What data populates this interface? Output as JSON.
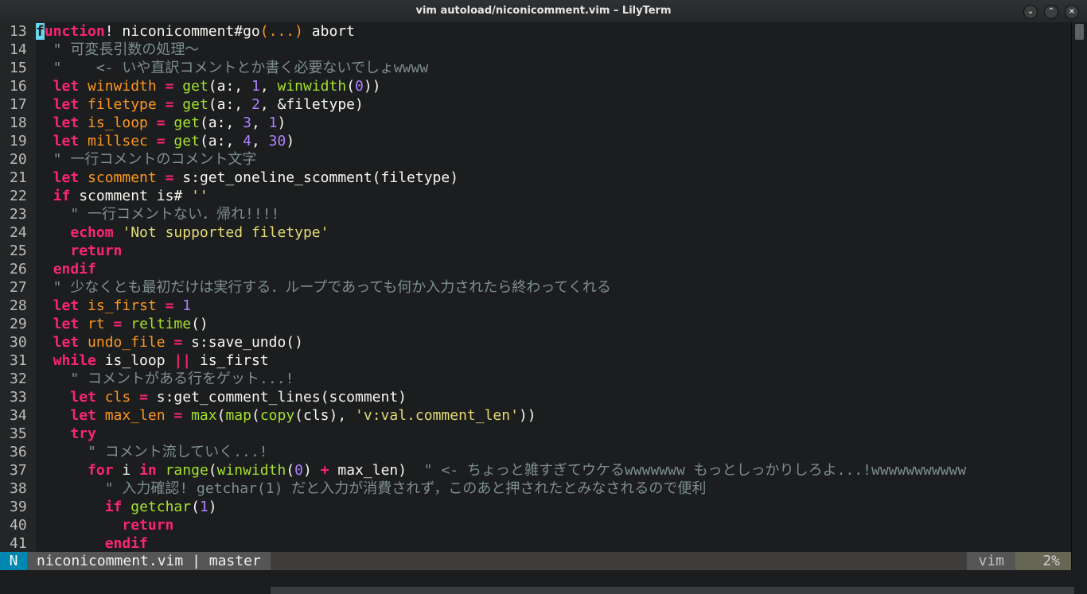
{
  "window": {
    "title": "vim autoload/niconicomment.vim – LilyTerm"
  },
  "lines": [
    {
      "n": "13",
      "tokens": [
        {
          "t": "f",
          "c": "kw cur"
        },
        {
          "t": "unction",
          "c": "kw"
        },
        {
          "t": "! niconicomment#go",
          "c": "code"
        },
        {
          "t": "(...)",
          "c": "var"
        },
        {
          "t": " abort",
          "c": "code"
        }
      ]
    },
    {
      "n": "14",
      "tokens": [
        {
          "t": "  \" 可変長引数の処理〜",
          "c": "cmt"
        }
      ]
    },
    {
      "n": "15",
      "tokens": [
        {
          "t": "  \"    <- いや直訳コメントとか書く必要ないでしょwwww",
          "c": "cmt"
        }
      ]
    },
    {
      "n": "16",
      "tokens": [
        {
          "t": "  ",
          "c": "code"
        },
        {
          "t": "let",
          "c": "kw"
        },
        {
          "t": " winwidth",
          "c": "var"
        },
        {
          "t": " = ",
          "c": "kw"
        },
        {
          "t": "get",
          "c": "fn"
        },
        {
          "t": "(a:, ",
          "c": "code"
        },
        {
          "t": "1",
          "c": "num"
        },
        {
          "t": ", ",
          "c": "code"
        },
        {
          "t": "winwidth",
          "c": "fn"
        },
        {
          "t": "(",
          "c": "code"
        },
        {
          "t": "0",
          "c": "num"
        },
        {
          "t": "))",
          "c": "code"
        }
      ]
    },
    {
      "n": "17",
      "tokens": [
        {
          "t": "  ",
          "c": "code"
        },
        {
          "t": "let",
          "c": "kw"
        },
        {
          "t": " filetype",
          "c": "var"
        },
        {
          "t": " = ",
          "c": "kw"
        },
        {
          "t": "get",
          "c": "fn"
        },
        {
          "t": "(a:, ",
          "c": "code"
        },
        {
          "t": "2",
          "c": "num"
        },
        {
          "t": ", &filetype)",
          "c": "code"
        }
      ]
    },
    {
      "n": "18",
      "tokens": [
        {
          "t": "  ",
          "c": "code"
        },
        {
          "t": "let",
          "c": "kw"
        },
        {
          "t": " is_loop",
          "c": "var"
        },
        {
          "t": " = ",
          "c": "kw"
        },
        {
          "t": "get",
          "c": "fn"
        },
        {
          "t": "(a:, ",
          "c": "code"
        },
        {
          "t": "3",
          "c": "num"
        },
        {
          "t": ", ",
          "c": "code"
        },
        {
          "t": "1",
          "c": "num"
        },
        {
          "t": ")",
          "c": "code"
        }
      ]
    },
    {
      "n": "19",
      "tokens": [
        {
          "t": "  ",
          "c": "code"
        },
        {
          "t": "let",
          "c": "kw"
        },
        {
          "t": " millsec",
          "c": "var"
        },
        {
          "t": " = ",
          "c": "kw"
        },
        {
          "t": "get",
          "c": "fn"
        },
        {
          "t": "(a:, ",
          "c": "code"
        },
        {
          "t": "4",
          "c": "num"
        },
        {
          "t": ", ",
          "c": "code"
        },
        {
          "t": "30",
          "c": "num"
        },
        {
          "t": ")",
          "c": "code"
        }
      ]
    },
    {
      "n": "20",
      "tokens": [
        {
          "t": "  \" 一行コメントのコメント文字",
          "c": "cmt"
        }
      ]
    },
    {
      "n": "21",
      "tokens": [
        {
          "t": "  ",
          "c": "code"
        },
        {
          "t": "let",
          "c": "kw"
        },
        {
          "t": " scomment",
          "c": "var"
        },
        {
          "t": " = ",
          "c": "kw"
        },
        {
          "t": "s:get_oneline_scomment(filetype)",
          "c": "code"
        }
      ]
    },
    {
      "n": "22",
      "tokens": [
        {
          "t": "  ",
          "c": "code"
        },
        {
          "t": "if",
          "c": "kw"
        },
        {
          "t": " scomment is# ",
          "c": "code"
        },
        {
          "t": "''",
          "c": "str"
        }
      ]
    },
    {
      "n": "23",
      "tokens": [
        {
          "t": "    \" 一行コメントない．帰れ!!!!",
          "c": "cmt"
        }
      ]
    },
    {
      "n": "24",
      "tokens": [
        {
          "t": "    ",
          "c": "code"
        },
        {
          "t": "echom",
          "c": "kw"
        },
        {
          "t": " 'Not supported filetype'",
          "c": "str"
        }
      ]
    },
    {
      "n": "25",
      "tokens": [
        {
          "t": "    ",
          "c": "code"
        },
        {
          "t": "return",
          "c": "kw"
        }
      ]
    },
    {
      "n": "26",
      "tokens": [
        {
          "t": "  ",
          "c": "code"
        },
        {
          "t": "endif",
          "c": "kw"
        }
      ]
    },
    {
      "n": "27",
      "tokens": [
        {
          "t": "  \" 少なくとも最初だけは実行する．ループであっても何か入力されたら終わってくれる",
          "c": "cmt"
        }
      ]
    },
    {
      "n": "28",
      "tokens": [
        {
          "t": "  ",
          "c": "code"
        },
        {
          "t": "let",
          "c": "kw"
        },
        {
          "t": " is_first",
          "c": "var"
        },
        {
          "t": " = ",
          "c": "kw"
        },
        {
          "t": "1",
          "c": "num"
        }
      ]
    },
    {
      "n": "29",
      "tokens": [
        {
          "t": "  ",
          "c": "code"
        },
        {
          "t": "let",
          "c": "kw"
        },
        {
          "t": " rt",
          "c": "var"
        },
        {
          "t": " = ",
          "c": "kw"
        },
        {
          "t": "reltime",
          "c": "fn"
        },
        {
          "t": "()",
          "c": "code"
        }
      ]
    },
    {
      "n": "30",
      "tokens": [
        {
          "t": "  ",
          "c": "code"
        },
        {
          "t": "let",
          "c": "kw"
        },
        {
          "t": " undo_file",
          "c": "var"
        },
        {
          "t": " = ",
          "c": "kw"
        },
        {
          "t": "s:save_undo()",
          "c": "code"
        }
      ]
    },
    {
      "n": "31",
      "tokens": [
        {
          "t": "  ",
          "c": "code"
        },
        {
          "t": "while",
          "c": "kw"
        },
        {
          "t": " is_loop ",
          "c": "code"
        },
        {
          "t": "||",
          "c": "kw"
        },
        {
          "t": " is_first",
          "c": "code"
        }
      ]
    },
    {
      "n": "32",
      "tokens": [
        {
          "t": "    \" コメントがある行をゲット...!",
          "c": "cmt"
        }
      ]
    },
    {
      "n": "33",
      "tokens": [
        {
          "t": "    ",
          "c": "code"
        },
        {
          "t": "let",
          "c": "kw"
        },
        {
          "t": " cls",
          "c": "var"
        },
        {
          "t": " = ",
          "c": "kw"
        },
        {
          "t": "s:get_comment_lines(scomment)",
          "c": "code"
        }
      ]
    },
    {
      "n": "34",
      "tokens": [
        {
          "t": "    ",
          "c": "code"
        },
        {
          "t": "let",
          "c": "kw"
        },
        {
          "t": " max_len",
          "c": "var"
        },
        {
          "t": " = ",
          "c": "kw"
        },
        {
          "t": "max",
          "c": "fn"
        },
        {
          "t": "(",
          "c": "code"
        },
        {
          "t": "map",
          "c": "fn"
        },
        {
          "t": "(",
          "c": "code"
        },
        {
          "t": "copy",
          "c": "fn"
        },
        {
          "t": "(cls), ",
          "c": "code"
        },
        {
          "t": "'v:val.comment_len'",
          "c": "str"
        },
        {
          "t": "))",
          "c": "code"
        }
      ]
    },
    {
      "n": "35",
      "tokens": [
        {
          "t": "    ",
          "c": "code"
        },
        {
          "t": "try",
          "c": "kw"
        }
      ]
    },
    {
      "n": "36",
      "tokens": [
        {
          "t": "      \" コメント流していく...!",
          "c": "cmt"
        }
      ]
    },
    {
      "n": "37",
      "tokens": [
        {
          "t": "      ",
          "c": "code"
        },
        {
          "t": "for",
          "c": "kw"
        },
        {
          "t": " i ",
          "c": "code"
        },
        {
          "t": "in",
          "c": "kw"
        },
        {
          "t": " ",
          "c": "code"
        },
        {
          "t": "range",
          "c": "fn"
        },
        {
          "t": "(",
          "c": "code"
        },
        {
          "t": "winwidth",
          "c": "fn"
        },
        {
          "t": "(",
          "c": "code"
        },
        {
          "t": "0",
          "c": "num"
        },
        {
          "t": ") ",
          "c": "code"
        },
        {
          "t": "+",
          "c": "kw"
        },
        {
          "t": " max_len)  ",
          "c": "code"
        },
        {
          "t": "\" <- ちょっと雑すぎてウケるwwwwwww もっとしっかりしろよ...!wwwwwwwwwww",
          "c": "cmt"
        }
      ]
    },
    {
      "n": "38",
      "tokens": [
        {
          "t": "        \" 入力確認! getchar(1) だと入力が消費されず，このあと押されたとみなされるので便利",
          "c": "cmt"
        }
      ]
    },
    {
      "n": "39",
      "tokens": [
        {
          "t": "        ",
          "c": "code"
        },
        {
          "t": "if",
          "c": "kw"
        },
        {
          "t": " ",
          "c": "code"
        },
        {
          "t": "getchar",
          "c": "fn"
        },
        {
          "t": "(",
          "c": "code"
        },
        {
          "t": "1",
          "c": "num"
        },
        {
          "t": ")",
          "c": "code"
        }
      ]
    },
    {
      "n": "40",
      "tokens": [
        {
          "t": "          ",
          "c": "code"
        },
        {
          "t": "return",
          "c": "kw"
        }
      ]
    },
    {
      "n": "41",
      "tokens": [
        {
          "t": "        ",
          "c": "code"
        },
        {
          "t": "endif",
          "c": "kw"
        }
      ]
    }
  ],
  "statusline": {
    "mode": "N",
    "file": "niconicomment.vim | master",
    "filetype": "vim",
    "percent": "2%"
  }
}
